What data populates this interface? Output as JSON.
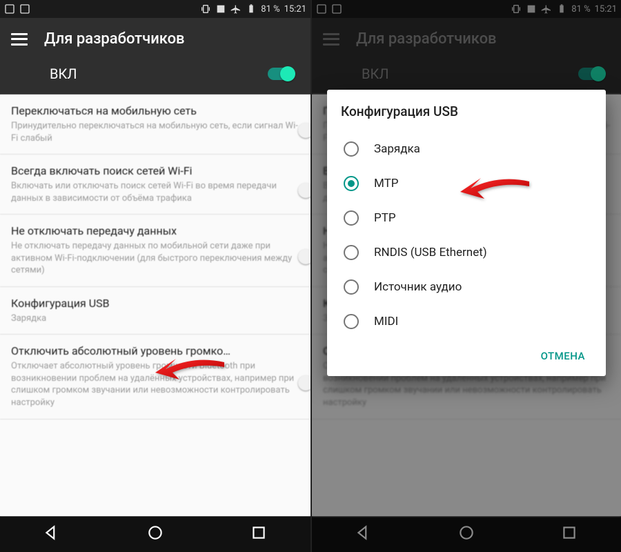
{
  "status": {
    "battery_pct": "81 %",
    "time": "15:21"
  },
  "header": {
    "title": "Для разработчиков",
    "master_switch_label": "ВКЛ"
  },
  "settings": [
    {
      "title": "Переключаться на мобильную сеть",
      "sub": "Принудительно переключаться на мобильную сеть, если сигнал Wi-Fi слабый",
      "has_switch": true
    },
    {
      "title": "Всегда включать поиск сетей Wi-Fi",
      "sub": "Включать или отключать поиск сетей Wi-Fi во время передачи данных в зависимости от объёма трафика",
      "has_switch": true
    },
    {
      "title": "Не отключать передачу данных",
      "sub": "Не отключать передачу данных по мобильной сети даже при активном Wi-Fi-подключении (для быстрого переключения между сетями)",
      "has_switch": true
    },
    {
      "title": "Конфигурация USB",
      "sub": "Зарядка",
      "has_switch": false
    },
    {
      "title": "Отключить абсолютный уровень громко…",
      "sub": "Отключает абсолютный уровень громкости Bluetooth при возникновении проблем на удалённых устройствах, например при слишком громком звучании или невозможности контролировать настройку",
      "has_switch": true
    }
  ],
  "dialog": {
    "title": "Конфигурация USB",
    "options": [
      {
        "label": "Зарядка",
        "checked": false
      },
      {
        "label": "MTP",
        "checked": true
      },
      {
        "label": "PTP",
        "checked": false
      },
      {
        "label": "RNDIS (USB Ethernet)",
        "checked": false
      },
      {
        "label": "Источник аудио",
        "checked": false
      },
      {
        "label": "MIDI",
        "checked": false
      }
    ],
    "cancel": "ОТМЕНА"
  }
}
